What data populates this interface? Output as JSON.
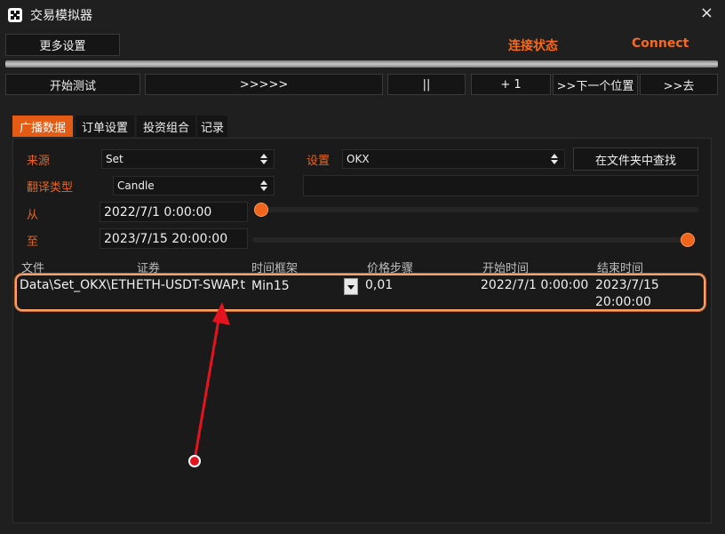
{
  "window": {
    "title": "交易模拟器",
    "close": "×"
  },
  "toolbar": {
    "more_settings": "更多设置",
    "conn_status": "连接状态",
    "connect": "Connect"
  },
  "controls": {
    "start_test": "开始测试",
    "fast_forward": ">>>>>",
    "pause": "||",
    "plus_one": "+ 1",
    "next_position": ">>下一个位置",
    "go": ">>去"
  },
  "tabs": [
    {
      "label": "广播数据",
      "active": true
    },
    {
      "label": "订单设置",
      "active": false
    },
    {
      "label": "投资组合",
      "active": false
    },
    {
      "label": "记录",
      "active": false
    }
  ],
  "form": {
    "source_label": "来源",
    "source_value": "Set",
    "settings_label": "设置",
    "settings_value": "OKX",
    "find_in_folder": "在文件夹中查找",
    "translate_label": "翻译类型",
    "translate_value": "Candle",
    "from_label": "从",
    "from_value": "2022/7/1 0:00:00",
    "to_label": "至",
    "to_value": "2023/7/15 20:00:00"
  },
  "table": {
    "columns": [
      "文件",
      "证券",
      "时间框架",
      "价格步骤",
      "开始时间",
      "结束时间"
    ],
    "rows": [
      {
        "file": "Data\\Set_OKX\\ETH",
        "security": "ETH-USDT-SWAP.t",
        "timeframe": "Min15",
        "price_step": "0,01",
        "start": "2022/7/1 0:00:00",
        "end_date": "2023/7/15",
        "end_time": "20:00:00"
      }
    ]
  },
  "colors": {
    "accent": "#e8641f",
    "highlight": "#f5a26e",
    "arrow": "#e4141e"
  },
  "sliders": {
    "from_position": 0.0,
    "to_position": 1.0
  }
}
